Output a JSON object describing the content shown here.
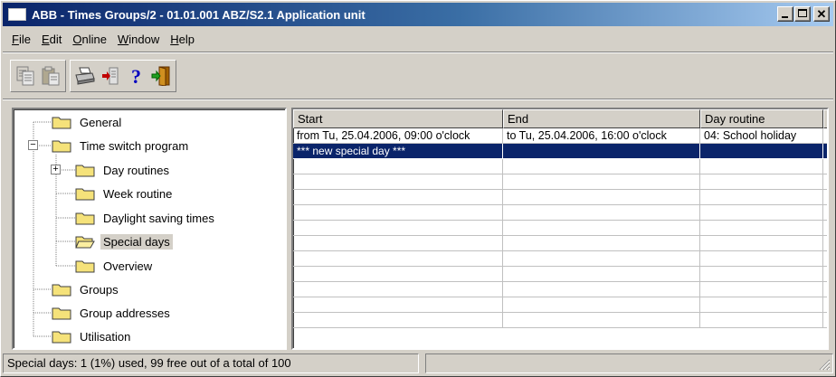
{
  "window": {
    "title": "ABB - Times Groups/2 - 01.01.001 ABZ/S2.1 Application unit"
  },
  "menu": [
    {
      "label": "File",
      "u": "F",
      "rest": "ile"
    },
    {
      "label": "Edit",
      "u": "E",
      "rest": "dit"
    },
    {
      "label": "Online",
      "u": "O",
      "rest": "nline"
    },
    {
      "label": "Window",
      "u": "W",
      "rest": "indow"
    },
    {
      "label": "Help",
      "u": "H",
      "rest": "elp"
    }
  ],
  "toolbar": {
    "icons": [
      "copy-icon",
      "paste-icon",
      "print-icon",
      "import-icon",
      "help-icon",
      "exit-icon"
    ]
  },
  "tree": {
    "items": [
      {
        "label": "General",
        "selected": false
      },
      {
        "label": "Time switch program",
        "selected": false,
        "expanded": true
      },
      {
        "label": "Day routines",
        "selected": false,
        "expanded": false
      },
      {
        "label": "Week routine",
        "selected": false
      },
      {
        "label": "Daylight saving times",
        "selected": false
      },
      {
        "label": "Special days",
        "selected": true
      },
      {
        "label": "Overview",
        "selected": false
      },
      {
        "label": "Groups",
        "selected": false
      },
      {
        "label": "Group addresses",
        "selected": false
      },
      {
        "label": "Utilisation",
        "selected": false
      }
    ]
  },
  "grid": {
    "columns": [
      "Start",
      "End",
      "Day routine"
    ],
    "rows": [
      [
        "from Tu, 25.04.2006, 09:00 o'clock",
        "to Tu, 25.04.2006, 16:00 o'clock",
        "04: School holiday"
      ],
      [
        "*** new special day ***",
        "",
        ""
      ]
    ],
    "selected_row": 1
  },
  "status": {
    "text": "Special days: 1 (1%) used, 99 free out of a total of 100"
  },
  "colors": {
    "title_start": "#0a246a",
    "title_end": "#a6caf0",
    "selection": "#0a246a",
    "folder": "#f5e27a"
  }
}
